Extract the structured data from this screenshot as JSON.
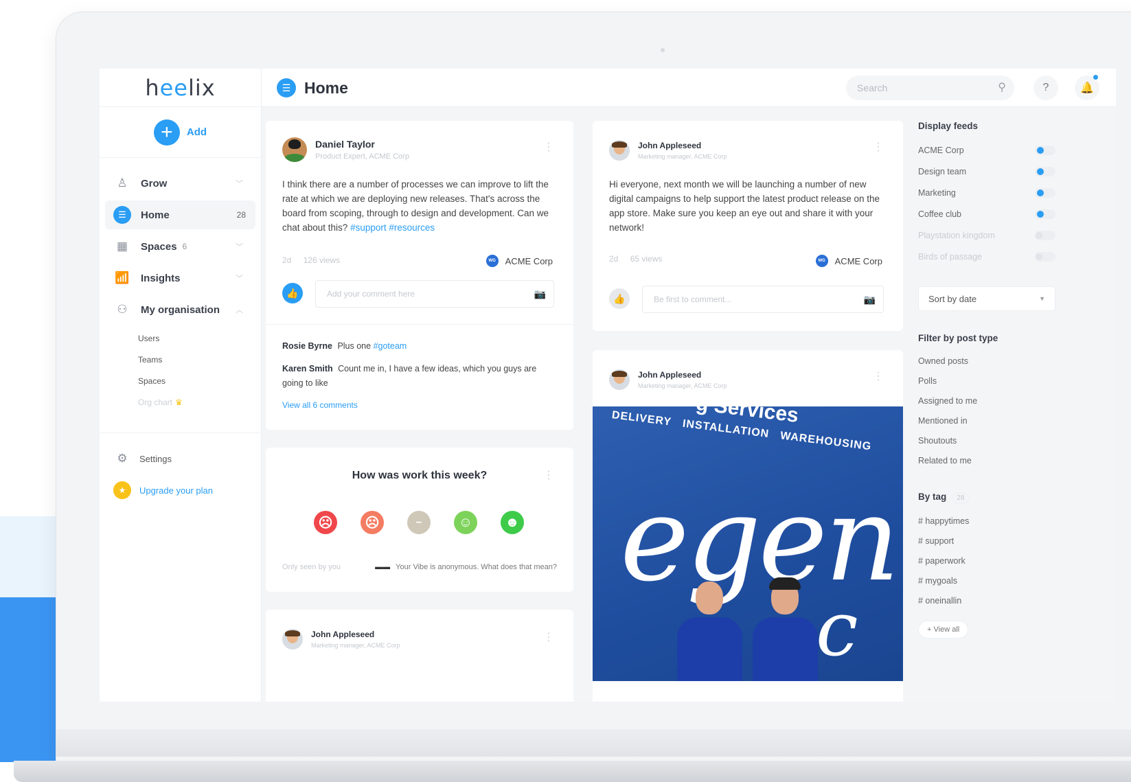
{
  "app": {
    "logo_prefix": "h",
    "logo_ee": "ee",
    "logo_suffix": "lix",
    "add_label": "Add"
  },
  "sidebar": {
    "items": [
      {
        "label": "Grow",
        "count": "",
        "icon": "person-icon"
      },
      {
        "label": "Home",
        "count": "28",
        "icon": "home-feed-icon"
      },
      {
        "label": "Spaces",
        "count": "6",
        "icon": "grid-icon"
      },
      {
        "label": "Insights",
        "count": "",
        "icon": "bar-chart-icon"
      },
      {
        "label": "My organisation",
        "count": "",
        "icon": "org-chart-icon"
      }
    ],
    "subitems": [
      "Users",
      "Teams",
      "Spaces",
      "Org chart"
    ],
    "settings_label": "Settings",
    "upgrade_label": "Upgrade your plan"
  },
  "header": {
    "title": "Home",
    "search_placeholder": "Search",
    "help_glyph": "?"
  },
  "posts": {
    "daniel": {
      "name": "Daniel Taylor",
      "role": "Product Expert, ACME Corp",
      "text": "I think there are a number of processes we can improve to lift the rate at which we are deploying new releases. That's across the board from scoping, through to design and development. Can we chat about this?",
      "tags": "#support #resources",
      "age": "2d",
      "views": "126 views",
      "space": "ACME Corp",
      "comment_placeholder": "Add your comment here",
      "comments": [
        {
          "author": "Rosie Byrne",
          "text": "Plus one",
          "tag": "#goteam"
        },
        {
          "author": "Karen Smith",
          "text": "Count me in, I have a few ideas, which you guys are going to like",
          "tag": ""
        }
      ],
      "view_all": "View all 6 comments"
    },
    "john1": {
      "name": "John Appleseed",
      "role": "Marketing manager, ACME Corp",
      "text": "Hi everyone, next month we will be launching a number of new digital campaigns to help support the latest product release on the app store. Make sure you keep an eye out and share it with your network!",
      "age": "2d",
      "views": "65 views",
      "space": "ACME Corp",
      "comment_placeholder": "Be first to comment..."
    },
    "john2": {
      "name": "John Appleseed",
      "role": "Marketing manager, ACME Corp",
      "photo_line1": "DELIVERY",
      "photo_line2": "INSTALLATION",
      "photo_line3": "WAREHOUSING",
      "photo_services": "g Services",
      "photo_big": "egen",
      "photo_big2": "c"
    },
    "john3": {
      "name": "John Appleseed",
      "role": "Marketing manager, ACME Corp"
    }
  },
  "poll": {
    "question": "How was work this week?",
    "faces": [
      {
        "glyph": "☹",
        "color": "#f0474b"
      },
      {
        "glyph": "☹",
        "color": "#f47c62"
      },
      {
        "glyph": "😐",
        "color": "#cfc8b8"
      },
      {
        "glyph": "☺",
        "color": "#7dd35a"
      },
      {
        "glyph": "☻",
        "color": "#3ecb4a"
      }
    ],
    "note_left": "Only seen by you",
    "note_right": "Your Vibe is anonymous. What does that mean?"
  },
  "right_panel": {
    "display_feeds_title": "Display feeds",
    "feeds": [
      {
        "label": "ACME Corp",
        "on": true
      },
      {
        "label": "Design team",
        "on": true
      },
      {
        "label": "Marketing",
        "on": true
      },
      {
        "label": "Coffee club",
        "on": true
      },
      {
        "label": "Playstation kingdom",
        "on": false
      },
      {
        "label": "Birds of passage",
        "on": false
      }
    ],
    "sort_label": "Sort by date",
    "filter_title": "Filter by post type",
    "post_types": [
      "Owned posts",
      "Polls",
      "Assigned to me",
      "Mentioned in",
      "Shoutouts",
      "Related to me"
    ],
    "by_tag_title": "By tag",
    "by_tag_count": "28",
    "tags": [
      "# happytimes",
      "# support",
      "# paperwork",
      "# mygoals",
      "# oneinallin"
    ],
    "view_all": "View all"
  },
  "colors": {
    "accent": "#2a9df4",
    "upgrade": "#f9c21a",
    "photo_blue": "#1f4d9e"
  }
}
